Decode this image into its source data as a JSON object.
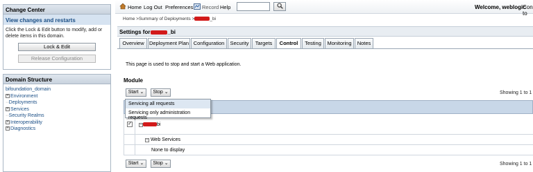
{
  "change_center": {
    "title": "Change Center",
    "subtitle": "View changes and restarts",
    "description": "Click the Lock & Edit button to modify, add or delete items in this domain.",
    "lock_edit_label": "Lock & Edit",
    "release_config_label": "Release Configuration"
  },
  "domain_structure": {
    "title": "Domain Structure",
    "root": "bifoundation_domain",
    "items": [
      {
        "label": "Environment",
        "expandable": true
      },
      {
        "label": "Deployments",
        "expandable": false
      },
      {
        "label": "Services",
        "expandable": true
      },
      {
        "label": "Security Realms",
        "expandable": false
      },
      {
        "label": "Interoperability",
        "expandable": true
      },
      {
        "label": "Diagnostics",
        "expandable": true
      }
    ]
  },
  "topbar": {
    "home": "Home",
    "logout": "Log Out",
    "preferences": "Preferences",
    "record": "Record",
    "help": "Help",
    "search_value": "",
    "welcome": "Welcome, weblogic",
    "connected": "Connected to"
  },
  "breadcrumb": {
    "prefix": "Home >Summary of Deployments >",
    "suffix": "_bi"
  },
  "settings": {
    "prefix": "Settings for",
    "suffix": "_bi"
  },
  "tabs": [
    "Overview",
    "Deployment Plan",
    "Configuration",
    "Security",
    "Targets",
    "Control",
    "Testing",
    "Monitoring",
    "Notes"
  ],
  "active_tab": "Control",
  "description": "This page is used to stop and start a Web application.",
  "module_heading": "Module",
  "start_label": "Start",
  "stop_label": "Stop",
  "showing_text": "Showing 1 to 1",
  "dropdown": {
    "items": [
      "Servicing all requests",
      "Servicing only administration requests"
    ],
    "highlighted_index": 0
  },
  "table": {
    "app_row_suffix": "bi",
    "app_checked": true,
    "web_services_label": "Web Services",
    "none_label": "None to display"
  },
  "colors": {
    "accent": "#1b4f86",
    "header_bg": "#c8d7e8",
    "redaction": "#d21a1a"
  }
}
